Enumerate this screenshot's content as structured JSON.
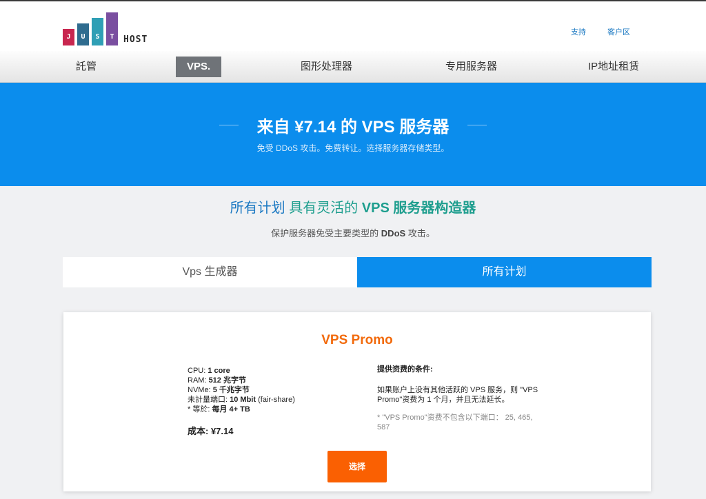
{
  "brand": {
    "letters": [
      "J",
      "U",
      "S",
      "T"
    ],
    "word": "HOST",
    "colors": [
      "#c8264f",
      "#2f6c8f",
      "#2f9fb5",
      "#7a4fa0"
    ]
  },
  "top_links": [
    "支持",
    "客户区"
  ],
  "nav": {
    "items": [
      "託管",
      "VPS.",
      "图形处理器",
      "专用服务器",
      "IP地址租赁"
    ],
    "active": "VPS."
  },
  "hero": {
    "title": "来自 ¥7.14 的 VPS 服务器",
    "subtitle": "免受 DDoS 攻击。免费转让。选择服务器存储类型。"
  },
  "section": {
    "title_a": "所有计划",
    "title_b": "具有灵活的",
    "title_c": "VPS 服务器构造器",
    "sub_a": "保护服务器免受主要类型的",
    "sub_b": "DDoS",
    "sub_c": "攻击。"
  },
  "tabs": {
    "builder": "Vps 生成器",
    "plans": "所有计划"
  },
  "plan": {
    "name": "VPS Promo",
    "specs": [
      {
        "label": "CPU:",
        "value": "1 core",
        "extra": ""
      },
      {
        "label": "RAM:",
        "value": "512 兆字节",
        "extra": ""
      },
      {
        "label": "NVMe:",
        "value": "5 千兆字节",
        "extra": ""
      },
      {
        "label": "未計量端口:",
        "value": "10 Mbit",
        "extra": "(fair-share)"
      },
      {
        "label": "* 等於:",
        "value": "每月 4+ TB",
        "extra": ""
      }
    ],
    "cost": "成本: ¥7.14",
    "conditions_title": "提供资费的条件:",
    "conditions_text": "如果账户上没有其他活跃的 VPS 服务，则 \"VPS Promo\"资费为 1 个月，并且无法延长。",
    "conditions_note": "* \"VPS Promo\"资费不包含以下端口： 25, 465, 587",
    "select_label": "选择"
  },
  "colors": {
    "accent_blue": "#0b8ded",
    "accent_orange": "#fa6002",
    "teal": "#1e9e8e"
  }
}
